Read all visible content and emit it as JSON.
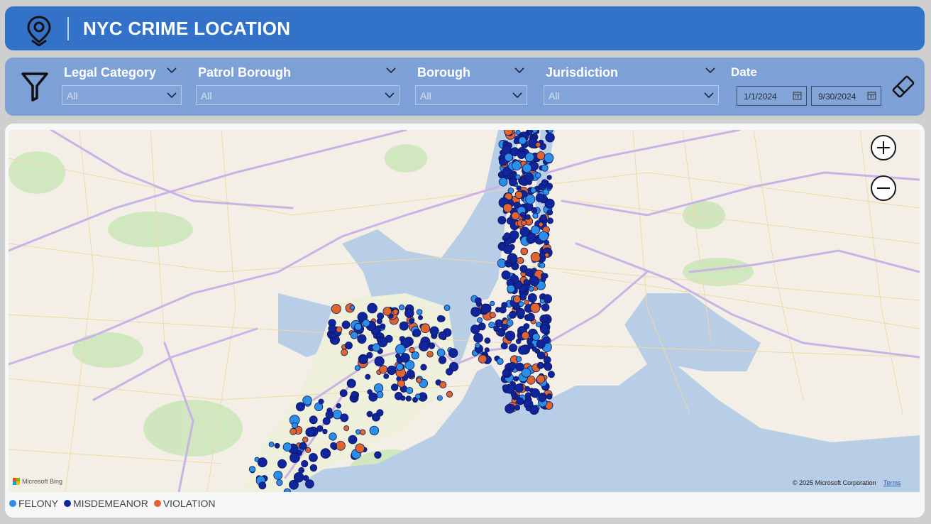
{
  "header": {
    "title": "NYC CRIME LOCATION",
    "icon": "map-pin-icon"
  },
  "filters": {
    "icon": "funnel-icon",
    "slicers": [
      {
        "label": "Legal Category",
        "value": "All"
      },
      {
        "label": "Patrol Borough",
        "value": "All"
      },
      {
        "label": "Borough",
        "value": "All"
      },
      {
        "label": "Jurisdiction",
        "value": "All"
      }
    ],
    "date": {
      "label": "Date",
      "start": "1/1/2024",
      "end": "9/30/2024"
    },
    "clear_icon": "eraser-icon"
  },
  "map": {
    "provider": "Microsoft Bing",
    "copyright": "© 2025 Microsoft Corporation",
    "terms": "Terms",
    "zoom_in_icon": "zoom-in-icon",
    "zoom_out_icon": "zoom-out-icon"
  },
  "legend": [
    {
      "label": "FELONY",
      "color": "#2b8fe8"
    },
    {
      "label": "MISDEMEANOR",
      "color": "#10249c"
    },
    {
      "label": "VIOLATION",
      "color": "#e0642d"
    }
  ],
  "colors": {
    "header": "#3372c9",
    "filterbar": "#7da0d6",
    "water": "#b8cde6",
    "park": "#c9e4b8"
  }
}
